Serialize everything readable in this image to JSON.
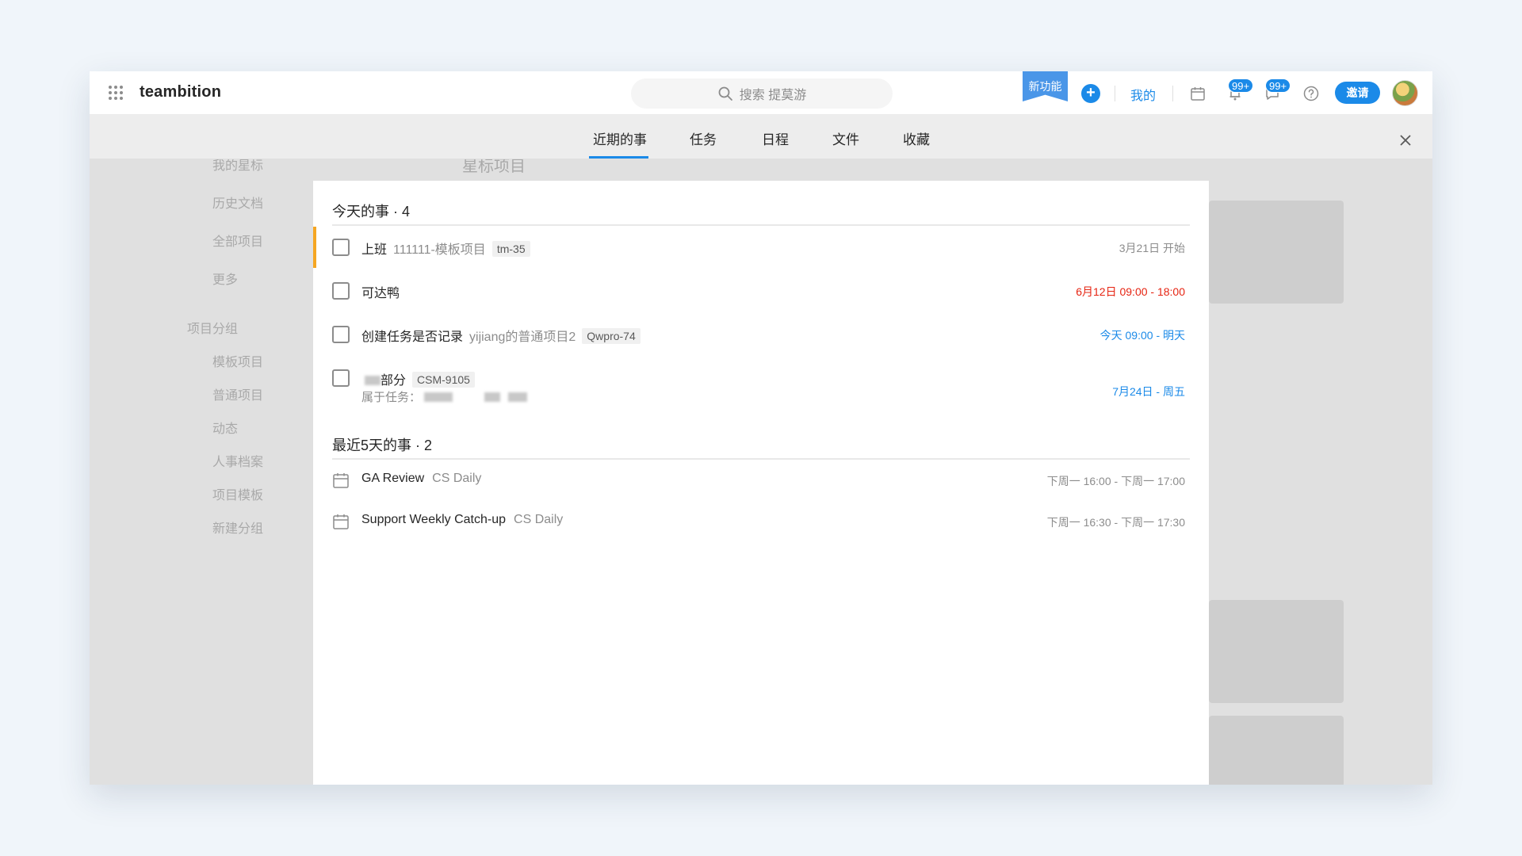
{
  "topbar": {
    "logo": "teambition",
    "search_placeholder": "搜索 提莫游",
    "new_feature_label": "新功能",
    "add_label": "+",
    "mine_label": "我的",
    "notifications_badge": "99+",
    "messages_badge": "99+",
    "invite_label": "邀请"
  },
  "background": {
    "sidebar_items": [
      "我的星标",
      "历史文档",
      "全部项目",
      "更多",
      "项目分组",
      "模板项目",
      "普通项目",
      "动态",
      "人事档案",
      "项目模板",
      "新建分组"
    ],
    "main_title": "星标项目"
  },
  "tabs": [
    {
      "label": "近期的事",
      "active": true
    },
    {
      "label": "任务",
      "active": false
    },
    {
      "label": "日程",
      "active": false
    },
    {
      "label": "文件",
      "active": false
    },
    {
      "label": "收藏",
      "active": false
    }
  ],
  "today": {
    "title": "今天的事 · 4",
    "items": [
      {
        "title": "上班",
        "project": "111111-模板项目",
        "tag": "tm-35",
        "time": "3月21日 开始",
        "time_color": "gray",
        "highlighted": true
      },
      {
        "title": "可达鸭",
        "project": "",
        "tag": "",
        "time": "6月12日 09:00 - 18:00",
        "time_color": "red",
        "highlighted": false
      },
      {
        "title": "创建任务是否记录",
        "project": "yijiang的普通项目2",
        "tag": "Qwpro-74",
        "time": "今天 09:00 - 明天",
        "time_color": "blue",
        "highlighted": false
      },
      {
        "title": "部分",
        "project": "",
        "tag": "CSM-9105",
        "sub_prefix": "属于任务：",
        "time": "7月24日 - 周五",
        "time_color": "blue",
        "highlighted": false
      }
    ]
  },
  "recent": {
    "title": "最近5天的事 · 2",
    "items": [
      {
        "title": "GA Review",
        "project": "CS Daily",
        "time": "下周一 16:00 - 下周一 17:00"
      },
      {
        "title": "Support Weekly Catch-up",
        "project": "CS Daily",
        "time": "下周一 16:30 - 下周一 17:30"
      }
    ]
  },
  "colors": {
    "accent": "#1b8ae8",
    "highlight_bar": "#f5a623",
    "red": "#e62412"
  }
}
